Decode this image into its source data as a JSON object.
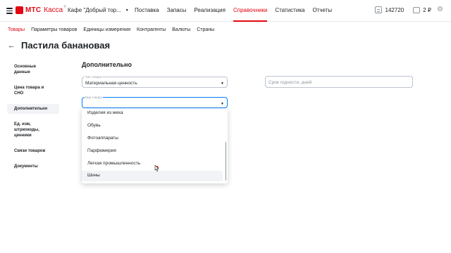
{
  "header": {
    "logo_brand": "МТС",
    "logo_product": "Касса",
    "logo_sup": "®",
    "store": "Кафе \"Добрый тор...",
    "nav": [
      "Поставка",
      "Запасы",
      "Реализация",
      "Справочники",
      "Статистика",
      "Отчеты"
    ],
    "active_nav": "Справочники",
    "balance": "142720",
    "money": "2 ₽"
  },
  "subnav": {
    "items": [
      "Товары",
      "Параметры товаров",
      "Единицы измерения",
      "Контрагенты",
      "Валюты",
      "Страны"
    ],
    "active": "Товары"
  },
  "page": {
    "title": "Пастила банановая"
  },
  "sidemenu": {
    "items": [
      "Основные данные",
      "Цена товара и СНО",
      "Дополнительно",
      "Ед. изм, штрихкоды, ценники",
      "Связи товаров",
      "Документы"
    ],
    "active": "Дополнительно"
  },
  "section": {
    "title": "Дополнительно",
    "product_type_label": "Тип товара",
    "product_type_value": "Материальная ценность",
    "product_kind_label": "Вид товара",
    "shelf_life_placeholder": "Срок годности, дней"
  },
  "dropdown": {
    "options": [
      "Изделия из меха",
      "Обувь",
      "Фотоаппараты",
      "Парфюмерия",
      "Легкая промышленность",
      "Шины"
    ],
    "hovered": "Шины"
  },
  "colors": {
    "brand": "#e30611",
    "focus": "#007cff"
  },
  "icons": {
    "menu": "burger-icon",
    "back": "arrow-left-icon",
    "balance": "counter-icon",
    "wallet": "wallet-icon",
    "settings": "gear-icon",
    "select": "chevron-down-icon"
  }
}
